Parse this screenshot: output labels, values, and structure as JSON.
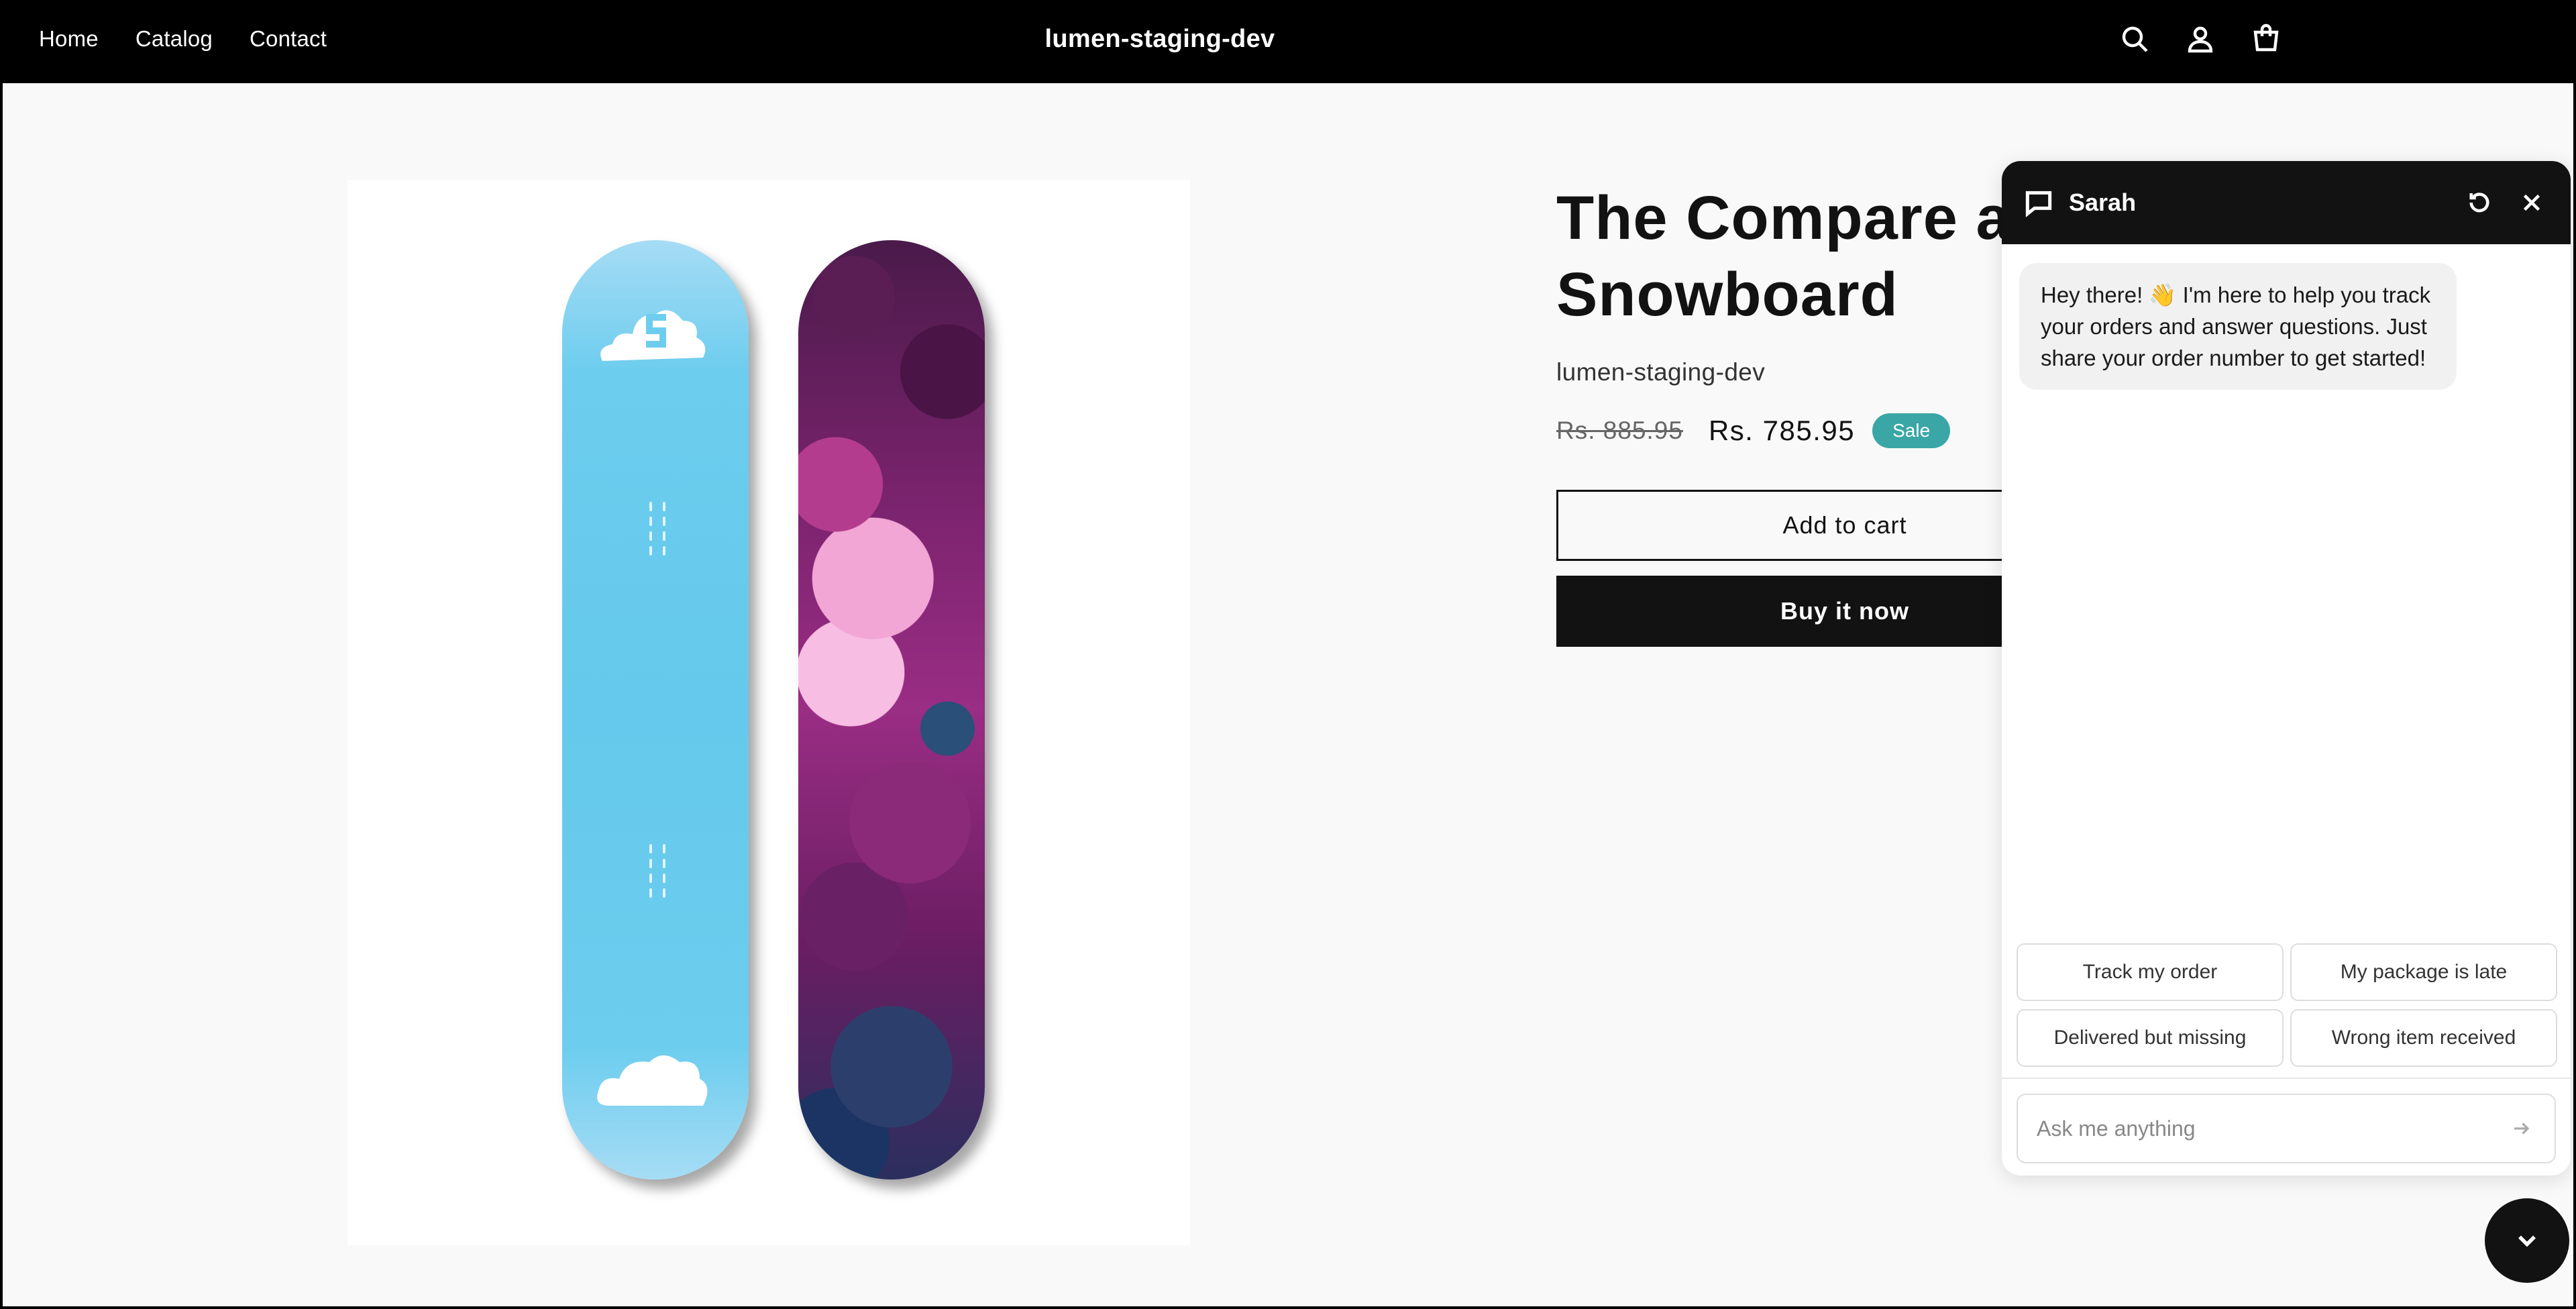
{
  "header": {
    "nav": [
      {
        "label": "Home"
      },
      {
        "label": "Catalog"
      },
      {
        "label": "Contact"
      }
    ],
    "brand": "lumen-staging-dev",
    "icons": [
      "search-icon",
      "account-icon",
      "cart-icon"
    ]
  },
  "product": {
    "title": "The Compare a… Snowboard",
    "title_line1": "The Compare a",
    "title_line2": "Snowboard",
    "vendor": "lumen-staging-dev",
    "price_regular": "Rs. 885.95",
    "price_sale": "Rs. 785.95",
    "badge": "Sale",
    "add_to_cart": "Add to cart",
    "buy_now": "Buy it now"
  },
  "chat": {
    "agent_name": "Sarah",
    "greeting": "Hey there! 👋 I'm here to help you track your orders and answer questions. Just share your order number to get started!",
    "quick_replies": [
      {
        "label": "Track my order"
      },
      {
        "label": "My package is late"
      },
      {
        "label": "Delivered but missing"
      },
      {
        "label": "Wrong item received"
      }
    ],
    "input_placeholder": "Ask me anything"
  },
  "colors": {
    "header_bg": "#000000",
    "page_bg": "#f9f9f9",
    "sale_badge": "#3aa6a6",
    "primary_button": "#121212"
  }
}
